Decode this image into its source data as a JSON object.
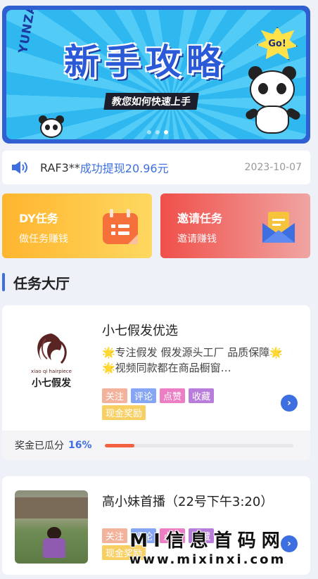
{
  "banner": {
    "title": "新手攻略",
    "subtitle": "教您如何快速上手",
    "brand": "YUNZAN",
    "go_badge": "Go!",
    "slides": 3,
    "active_slide": 3
  },
  "notice": {
    "icon": "speaker-icon",
    "user": "RAF3**",
    "message": "成功提现20.96元",
    "date": "2023-10-07"
  },
  "tasks": [
    {
      "title": "DY任务",
      "desc": "做任务赚钱",
      "icon": "calendar-icon"
    },
    {
      "title": "邀请任务",
      "desc": "邀请赚钱",
      "icon": "envelope-icon"
    }
  ],
  "section": {
    "title": "任务大厅"
  },
  "shops": [
    {
      "name": "小七假发优选",
      "logo_text": "小七假发",
      "logo_sub": "xiao qi hairpiece",
      "desc": "🌟专注假发 假发源头工厂 品质保障🌟 🌟视频同款都在商品橱窗…",
      "tags": [
        "关注",
        "评论",
        "点赞",
        "收藏",
        "现金奖励"
      ],
      "progress_label": "奖金已瓜分",
      "progress_pct": "16%",
      "progress_value": 0.16
    },
    {
      "name": "高小妹首播（22号下午3:20）",
      "tags": [
        "关注",
        "评论",
        "点赞",
        "收藏",
        "现金奖励"
      ]
    }
  ],
  "watermark": {
    "line1": "MI信息首码网",
    "line2": "www.mixinxi.com"
  },
  "colors": {
    "accent": "#3d6fe0",
    "progress": "#f3603f"
  }
}
